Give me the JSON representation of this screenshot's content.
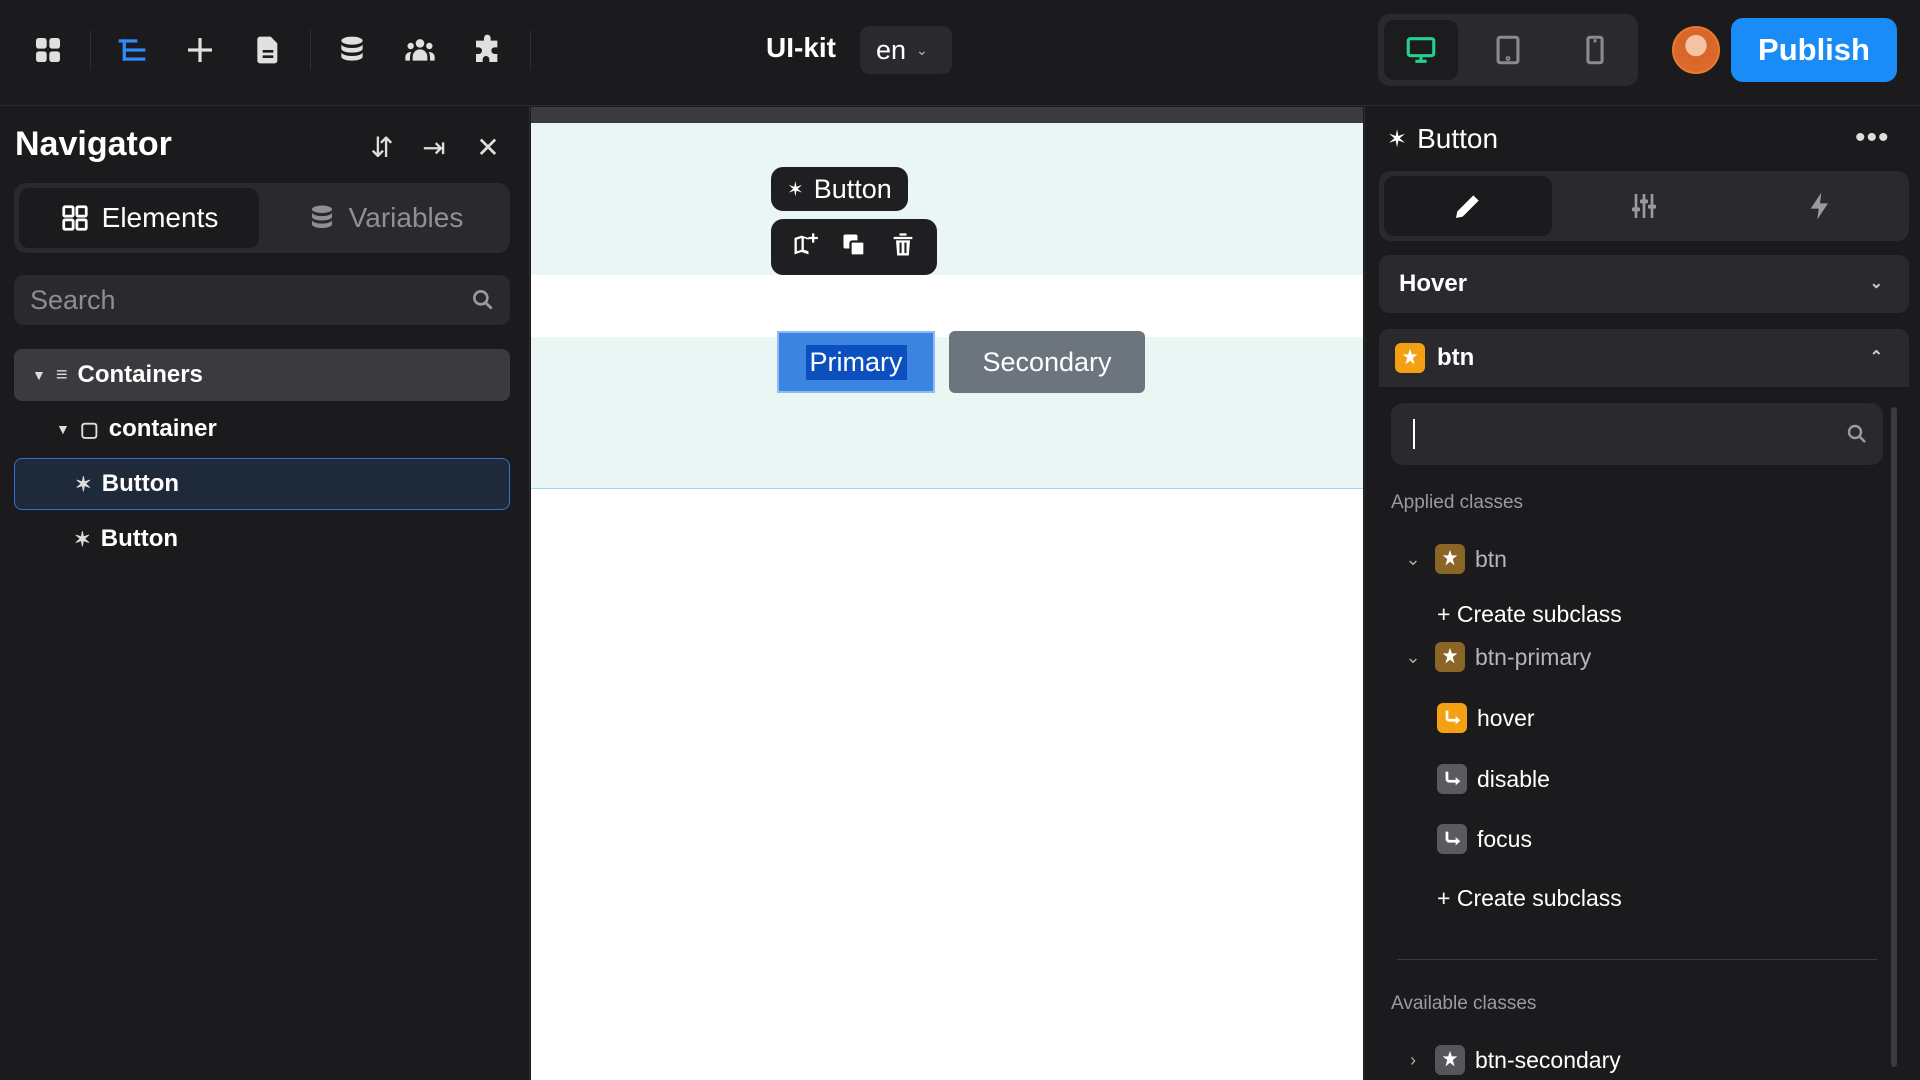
{
  "topbar": {
    "site_name": "UI-kit",
    "language": "en",
    "publish_label": "Publish",
    "tools": [
      "apps-icon",
      "navigator-icon",
      "add-icon",
      "pages-icon",
      "database-icon",
      "users-icon",
      "plugins-icon"
    ],
    "devices": [
      "desktop-icon",
      "tablet-icon",
      "mobile-icon"
    ],
    "accent": "#1a8cf8"
  },
  "navigator": {
    "title": "Navigator",
    "tabs": [
      {
        "label": "Elements",
        "active": true
      },
      {
        "label": "Variables",
        "active": false
      }
    ],
    "search_placeholder": "Search",
    "tree": [
      {
        "label": "Containers",
        "level": 0
      },
      {
        "label": "container",
        "level": 1
      },
      {
        "label": "Button",
        "level": 2,
        "selected": true
      },
      {
        "label": "Button",
        "level": 2
      }
    ]
  },
  "canvas": {
    "element_label": "Button",
    "primary_button": "Primary",
    "secondary_button": "Secondary"
  },
  "inspector": {
    "element_title": "Button",
    "state": "Hover",
    "class_name": "btn",
    "applied_label": "Applied classes",
    "applied_classes": [
      {
        "name": "btn",
        "create_label": "Create subclass"
      },
      {
        "name": "btn-primary",
        "create_label": "Create subclass",
        "states": [
          {
            "name": "hover",
            "active": true
          },
          {
            "name": "disable",
            "active": false
          },
          {
            "name": "focus",
            "active": false
          }
        ]
      }
    ],
    "available_label": "Available classes",
    "available_classes": [
      {
        "name": "btn-secondary"
      }
    ]
  }
}
